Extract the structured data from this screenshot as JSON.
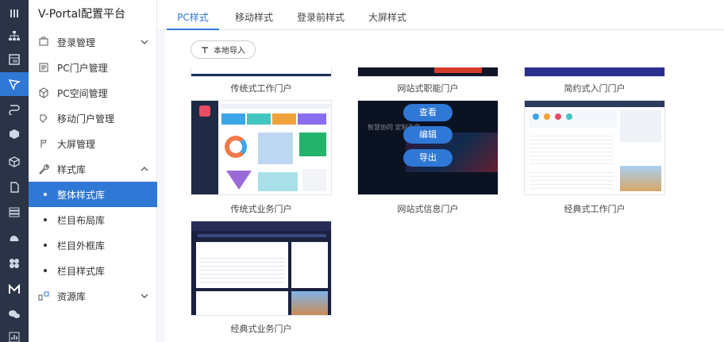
{
  "app_title": "V-Portal配置平台",
  "rail_icons": [
    "menu-icon",
    "sitemap-icon",
    "layout-icon",
    "brush-icon",
    "flow-icon",
    "cube-icon",
    "box-icon",
    "document-icon",
    "stack-icon",
    "cloud-icon",
    "cluster-icon",
    "m-logo-icon",
    "wechat-icon",
    "chart-icon"
  ],
  "sidebar": {
    "items": [
      {
        "label": "登录管理",
        "icon": "login-icon",
        "chevron": "down"
      },
      {
        "label": "PC门户管理",
        "icon": "pc-portal-icon"
      },
      {
        "label": "PC空间管理",
        "icon": "cube-icon"
      },
      {
        "label": "移动门户管理",
        "icon": "mobile-icon"
      },
      {
        "label": "大屏管理",
        "icon": "screen-icon"
      },
      {
        "label": "样式库",
        "icon": "wrench-icon",
        "chevron": "up"
      }
    ],
    "sub_items": [
      "整体样式库",
      "栏目布局库",
      "栏目外框库",
      "栏目样式库"
    ],
    "last_item": {
      "label": "资源库",
      "icon": "resource-icon",
      "chevron": "down"
    }
  },
  "tabs": [
    "PC样式",
    "移动样式",
    "登录前样式",
    "大屏样式"
  ],
  "import_button": {
    "label": "本地导入",
    "icon": "import-icon"
  },
  "cards": [
    {
      "caption": "传统式工作门户"
    },
    {
      "caption": "网站式职能门户"
    },
    {
      "caption": "简约式入门门户"
    },
    {
      "caption": "传统式业务门户"
    },
    {
      "caption": "网站式信息门户"
    },
    {
      "caption": "经典式工作门户"
    },
    {
      "caption": "经典式业务门户"
    }
  ],
  "overlay": {
    "view": "查看",
    "edit": "编辑",
    "export": "导出"
  },
  "thumb_texts": {
    "banner": "智慧协同 定制未来"
  },
  "colors": {
    "accent": "#2f78d6",
    "rail": "#2b3347"
  }
}
